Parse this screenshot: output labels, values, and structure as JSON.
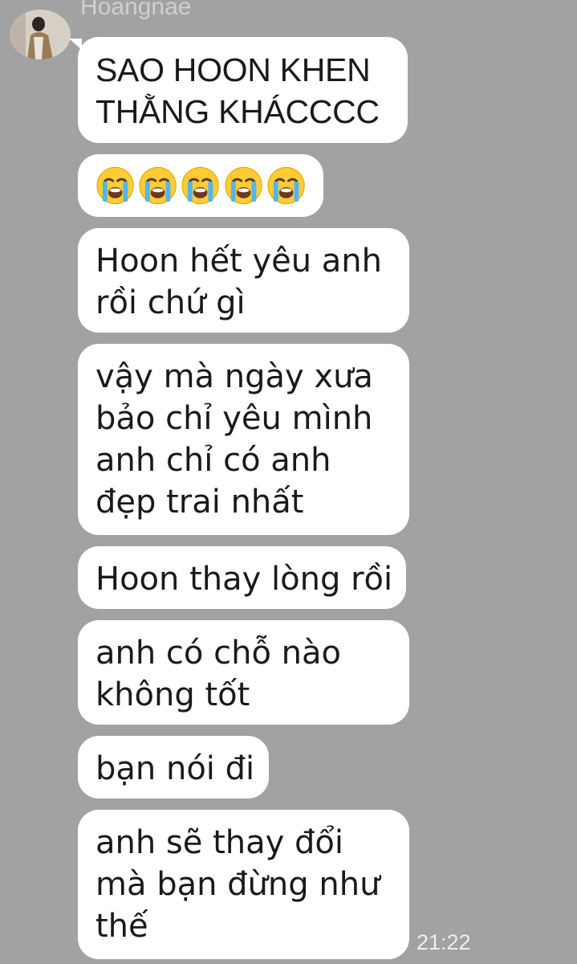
{
  "sender": {
    "name": "Hoangnae"
  },
  "messages": [
    {
      "lines": [
        "SAO HOON KHEN",
        "THẰNG KHÁCCCC"
      ]
    },
    {
      "emoji": [
        "loudly-crying-face",
        "loudly-crying-face",
        "loudly-crying-face",
        "loudly-crying-face",
        "loudly-crying-face"
      ]
    },
    {
      "lines": [
        "Hoon hết yêu anh",
        "rồi chứ gì"
      ]
    },
    {
      "lines": [
        "vậy mà ngày xưa",
        "bảo chỉ yêu mình",
        "anh chỉ có anh",
        "đẹp trai nhất"
      ]
    },
    {
      "lines": [
        "Hoon thay lòng rồi"
      ]
    },
    {
      "lines": [
        "anh có chỗ nào",
        "không tốt"
      ]
    },
    {
      "lines": [
        "bạn nói đi"
      ]
    },
    {
      "lines": [
        "anh sẽ thay đổi",
        "mà bạn đừng như",
        "thế"
      ]
    }
  ],
  "timestamp": "21:22",
  "colors": {
    "background": "#a2a2a2",
    "bubble": "#ffffff",
    "text": "#1a1a1a"
  }
}
